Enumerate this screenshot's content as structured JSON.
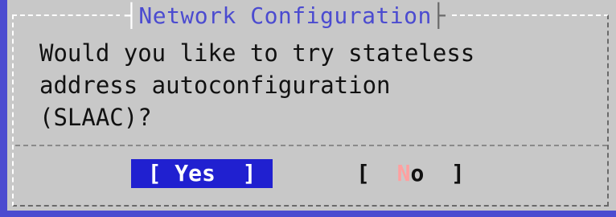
{
  "dialog": {
    "title": "Network Configuration",
    "message_lines": [
      "Would you like to try stateless",
      "address autoconfiguration",
      "(SLAAC)?"
    ]
  },
  "buttons": {
    "yes_label": "[ Yes  ]",
    "no_open": "[  ",
    "no_hotkey": "N",
    "no_rest": "o  ]"
  },
  "colors": {
    "background": "#4b4bd0",
    "dialog": "#c8c8c8",
    "title_text": "#4b4bd0",
    "selected_button_bg": "#2020d0",
    "hotkey": "#ffa0a0"
  }
}
